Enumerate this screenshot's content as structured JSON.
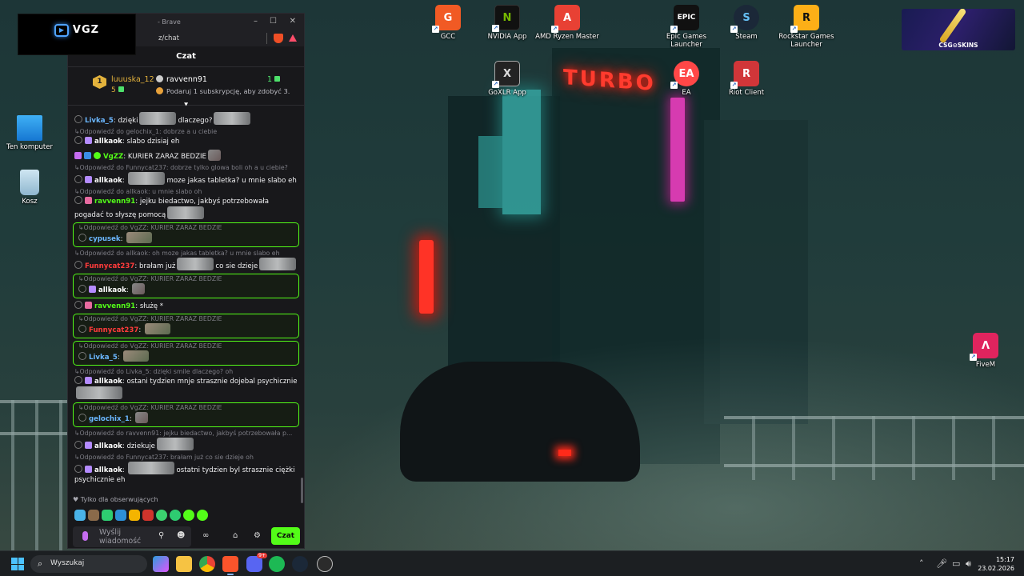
{
  "desktop": {
    "icons": [
      {
        "label": "GCC",
        "color": "#f15a24",
        "glyph": "G"
      },
      {
        "label": "NVIDIA App",
        "color": "#76b900",
        "glyph": "N"
      },
      {
        "label": "AMD Ryzen Master",
        "color": "#e84134",
        "glyph": "A"
      },
      {
        "label": "Epic Games Launcher",
        "color": "#111111",
        "glyph": "EPIC"
      },
      {
        "label": "Steam",
        "color": "#1b2838",
        "glyph": "S"
      },
      {
        "label": "Rockstar Games Launcher",
        "color": "#fcaf17",
        "glyph": "R"
      },
      {
        "label": "GoXLR App",
        "color": "#2a2a2a",
        "glyph": "X"
      },
      {
        "label": "EA",
        "color": "#ff4747",
        "glyph": "EA"
      },
      {
        "label": "Riot Client",
        "color": "#d13639",
        "glyph": "R"
      },
      {
        "label": "Ten komputer",
        "color": "#2a95e8",
        "glyph": ""
      },
      {
        "label": "Kosz",
        "color": "#9cc3db",
        "glyph": ""
      },
      {
        "label": "FiveM",
        "color": "#e0245e",
        "glyph": "Λ"
      }
    ],
    "wallpaper_sign": "TURBO"
  },
  "overlay": {
    "logo_text": "VGZ"
  },
  "widget": {
    "label": "CSG⊙SKINS"
  },
  "browser": {
    "title_suffix": "- Brave",
    "url_fragment": "z/chat"
  },
  "chat": {
    "header": "Czat",
    "pinned": {
      "user1": "luuuska_12",
      "user1_rank": "1",
      "user1_count": "5",
      "user2": "ravvenn91",
      "user2_count": "1",
      "note": "Podaruj 1 subskrypcję, aby zdobyć 3."
    },
    "messages": [
      {
        "user": "Livka_5",
        "color": "#6bb7ff",
        "pre": "",
        "text": "dzięki",
        "text2": "dlaczego?",
        "emote": "wide",
        "emote2": "wide"
      },
      {
        "reply": "Odpowiedź do gelochix_1: dobrze a u ciebie",
        "user": "allkaok",
        "color": "#b48bff",
        "text": "slabo dzisiaj eh"
      },
      {
        "user": "VgZZ",
        "color": "#53fc18",
        "text": "KURIER ZARAZ BEDZIE"
      },
      {
        "reply": "Odpowiedź do Funnycat237: dobrze tylko glowa boli oh a u ciebie?",
        "user": "allkaok",
        "color": "#b48bff",
        "text": "moze jakas tabletka? u mnie slabo eh"
      },
      {
        "reply": "Odpowiedź do allkaok: u mnie slabo oh",
        "user": "ravvenn91",
        "color": "#53fc18",
        "text": "jejku biedactwo, jakbyś potrzebowała pogadać to słyszę pomocą"
      },
      {
        "reply": "Odpowiedź do VgZZ: KURIER ZARAZ BEDZIE",
        "user": "cypusek",
        "color": "#6bb7ff",
        "text": ""
      },
      {
        "reply": "Odpowiedź do allkaok: oh moze jakas tabletka? u mnie slabo eh",
        "user": "Funnycat237",
        "color": "#ff3b3b",
        "text": "brałam już",
        "text2": "co sie dzieje"
      },
      {
        "reply": "Odpowiedź do VgZZ: KURIER ZARAZ BEDZIE",
        "user": "allkaok",
        "color": "#b48bff",
        "text": ""
      },
      {
        "user": "ravvenn91",
        "color": "#53fc18",
        "text": "służę *"
      },
      {
        "reply": "Odpowiedź do VgZZ: KURIER ZARAZ BEDZIE",
        "user": "Funnycat237",
        "color": "#ff3b3b",
        "text": ""
      },
      {
        "reply": "Odpowiedź do VgZZ: KURIER ZARAZ BEDZIE",
        "user": "Livka_5",
        "color": "#6bb7ff",
        "text": ""
      },
      {
        "reply": "Odpowiedź do Livka_5: dzięki smile dlaczego? oh",
        "user": "allkaok",
        "color": "#b48bff",
        "text": "ostani tydzien mnje strasznie dojebal psychicznie"
      },
      {
        "reply": "Odpowiedź do VgZZ: KURIER ZARAZ BEDZIE",
        "user": "gelochix_1",
        "color": "#6bb7ff",
        "text": ""
      },
      {
        "reply": "Odpowiedź do ravvenn91: jejku biedactwo, jakbyś potrzebowała p...",
        "user": "allkaok",
        "color": "#b48bff",
        "text": "dziekuje"
      },
      {
        "reply": "Odpowiedź do Funnycat237: brałam już co sie dzieje oh",
        "user": "allkaok",
        "color": "#b48bff",
        "text": "ostatni tydzien byl strasznie ciężki psychicznie eh"
      }
    ],
    "followers_only": "Tylko dla obserwujących",
    "input_placeholder": "Wyślij wiadomość",
    "send_label": "Czat"
  },
  "taskbar": {
    "search_placeholder": "Wyszukaj",
    "time": "15:17",
    "date": "23.02.2026",
    "discord_badge": "9+"
  }
}
